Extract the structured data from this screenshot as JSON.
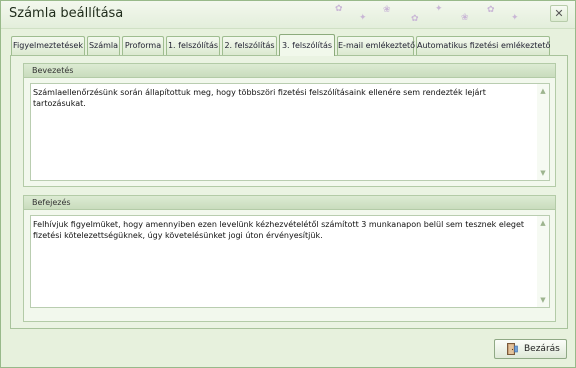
{
  "window": {
    "title": "Számla beállítása",
    "controls": {
      "close_glyph": "✕",
      "close_icon": "close-icon"
    }
  },
  "tabs": [
    {
      "label": "Figyelmeztetések"
    },
    {
      "label": "Számla"
    },
    {
      "label": "Proforma"
    },
    {
      "label": "1. felszólítás"
    },
    {
      "label": "2. felszólítás"
    },
    {
      "label": "3. felszólítás"
    },
    {
      "label": "E-mail emlékeztető"
    },
    {
      "label": "Automatikus fizetési emlékeztető"
    }
  ],
  "active_tab_index": 5,
  "intro": {
    "title": "Bevezetés",
    "text": "Számlaellenőrzésünk során állapítottuk meg, hogy többszöri fizetési felszólításaink ellenére sem rendezték lejárt tartozásukat."
  },
  "closing": {
    "title": "Befejezés",
    "text": "Felhívjuk figyelmüket, hogy amennyiben ezen levelünk kézhezvételétől számított 3 munkanapon belül sem tesznek eleget fizetési kötelezettségüknek, úgy követelésünket jogi úton érvényesítjük."
  },
  "footer": {
    "close_label": "Bezárás",
    "close_icon": "door-exit-icon"
  },
  "colors": {
    "accent_green": "#a8c39b",
    "window_bg": "#e7f1dd",
    "panel_bg": "#eaf3e2"
  }
}
